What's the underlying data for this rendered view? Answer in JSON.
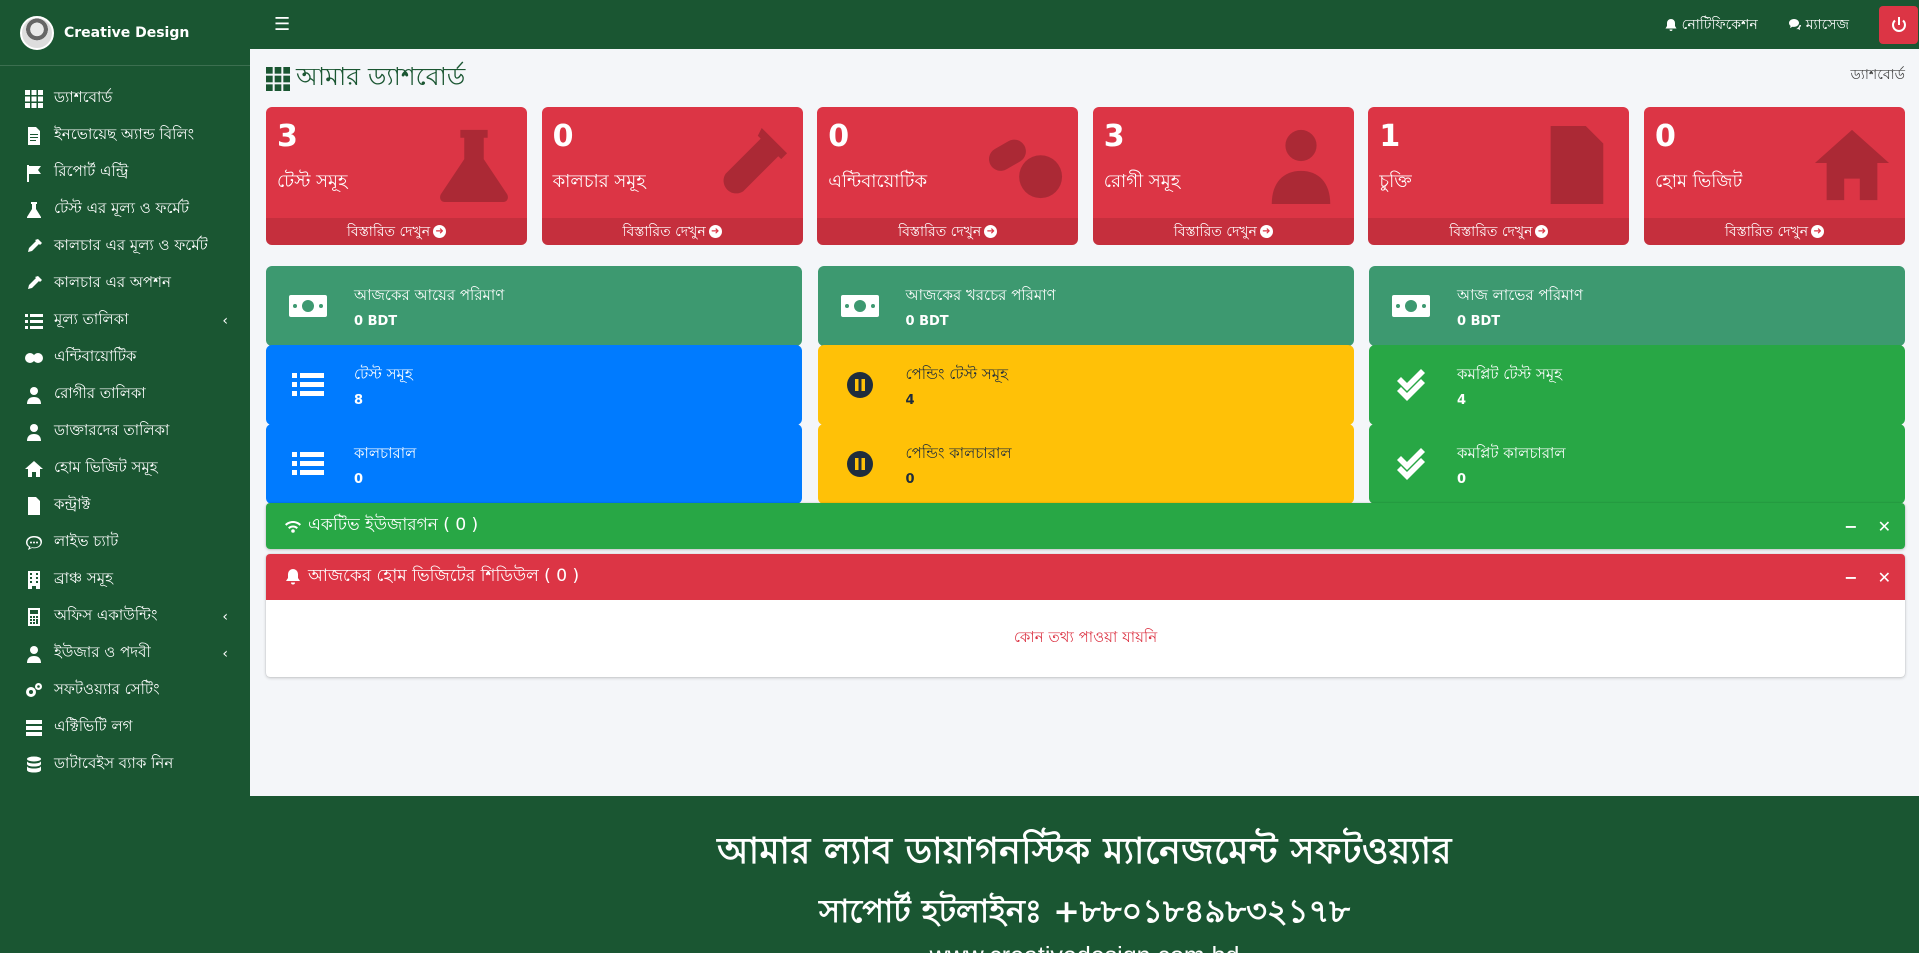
{
  "brand": {
    "name": "Creative Design"
  },
  "sidebar": {
    "items": [
      {
        "label": "ড্যাশবোর্ড",
        "icon": "grid-icon"
      },
      {
        "label": "ইনভোয়েছ অ্যান্ড বিলিং",
        "icon": "invoice-icon"
      },
      {
        "label": "রিপোর্ট এন্ট্রি",
        "icon": "flag-icon"
      },
      {
        "label": "টেস্ট এর মূল্য ও ফর্মেট",
        "icon": "flask-icon"
      },
      {
        "label": "কালচার এর মূল্য ও ফর্মেট",
        "icon": "eyedropper-icon"
      },
      {
        "label": "কালচার এর অপশন",
        "icon": "eyedropper-icon"
      },
      {
        "label": "মূল্য তালিকা",
        "icon": "list-icon",
        "chevron": "‹"
      },
      {
        "label": "এন্টিবায়োটিক",
        "icon": "pills-icon"
      },
      {
        "label": "রোগীর তালিকা",
        "icon": "patient-icon"
      },
      {
        "label": "ডাক্তারদের তালিকা",
        "icon": "doctor-icon"
      },
      {
        "label": "হোম ভিজিট সমূহ",
        "icon": "home-icon"
      },
      {
        "label": "কন্ট্রাক্ট",
        "icon": "contract-icon"
      },
      {
        "label": "লাইভ চ্যাট",
        "icon": "chat-icon"
      },
      {
        "label": "ব্রাঞ্চ সমূহ",
        "icon": "building-icon"
      },
      {
        "label": "অফিস একাউন্টিং",
        "icon": "calculator-icon",
        "chevron": "‹"
      },
      {
        "label": "ইউজার ও পদবী",
        "icon": "user-icon",
        "chevron": "‹"
      },
      {
        "label": "সফটওয়্যার সেটিং",
        "icon": "cogs-icon"
      },
      {
        "label": "এক্টিভিটি লগ",
        "icon": "server-icon"
      },
      {
        "label": "ডাটাবেইস ব্যাক নিন",
        "icon": "database-icon"
      }
    ]
  },
  "topbar": {
    "notification": "নোটিফিকেশন",
    "message": "ম্যাসেজ"
  },
  "page": {
    "title": "আমার ড্যাশবোর্ড",
    "breadcrumb": "ড্যাশবোর্ড"
  },
  "stats": [
    {
      "value": "3",
      "label": "টেস্ট সমূহ",
      "more": "বিস্তারিত দেখুন",
      "icon": "flask-icon"
    },
    {
      "value": "0",
      "label": "কালচার সমূহ",
      "more": "বিস্তারিত দেখুন",
      "icon": "test-tube-icon"
    },
    {
      "value": "0",
      "label": "এন্টিবায়োটিক",
      "more": "বিস্তারিত দেখুন",
      "icon": "pills-icon"
    },
    {
      "value": "3",
      "label": "রোগী সমূহ",
      "more": "বিস্তারিত দেখুন",
      "icon": "patient-icon"
    },
    {
      "value": "1",
      "label": "চুক্তি",
      "more": "বিস্তারিত দেখুন",
      "icon": "contract-icon"
    },
    {
      "value": "0",
      "label": "হোম ভিজিট",
      "more": "বিস্তারিত দেখুন",
      "icon": "home-icon"
    }
  ],
  "finance": [
    {
      "title": "আজকের আয়ের পরিমাণ",
      "value": "0 BDT",
      "icon": "money-icon"
    },
    {
      "title": "আজকের খরচের পরিমাণ",
      "value": "0 BDT",
      "icon": "money-icon"
    },
    {
      "title": "আজ লাভের পরিমাণ",
      "value": "0 BDT",
      "icon": "money-icon"
    }
  ],
  "tests": [
    {
      "title": "টেস্ট সমূহ",
      "value": "8",
      "icon": "list-icon"
    },
    {
      "title": "পেন্ডিং টেস্ট সমূহ",
      "value": "4",
      "icon": "pause-icon"
    },
    {
      "title": "কমপ্লিট টেস্ট সমূহ",
      "value": "4",
      "icon": "check-double-icon"
    }
  ],
  "cultures": [
    {
      "title": "কালচারাল",
      "value": "0",
      "icon": "list-icon"
    },
    {
      "title": "পেন্ডিং কালচারাল",
      "value": "0",
      "icon": "pause-icon"
    },
    {
      "title": "কমপ্লিট কালচারাল",
      "value": "0",
      "icon": "check-double-icon"
    }
  ],
  "active_users": {
    "title": "একটিভ ইউজারগন ( 0 )"
  },
  "home_visits": {
    "title": "আজকের হোম ভিজিটের শিডিউল ( 0 )",
    "empty": "কোন তথ্য পাওয়া যায়নি"
  },
  "footer": {
    "line1": "আমার ল্যাব ডায়াগনস্টিক ম্যানেজমেন্ট সফটওয়্যার",
    "line2": "সাপোর্ট হটলাইনঃ +৮৮০১৮৪৯৮৩২১৭৮",
    "line3": "www.creativedesign.com.bd"
  },
  "colors": {
    "primary": "#1a5632",
    "danger": "#dc3545",
    "teal": "#3d9970",
    "blue": "#007bff",
    "yellow": "#ffc107",
    "green": "#28a745"
  }
}
